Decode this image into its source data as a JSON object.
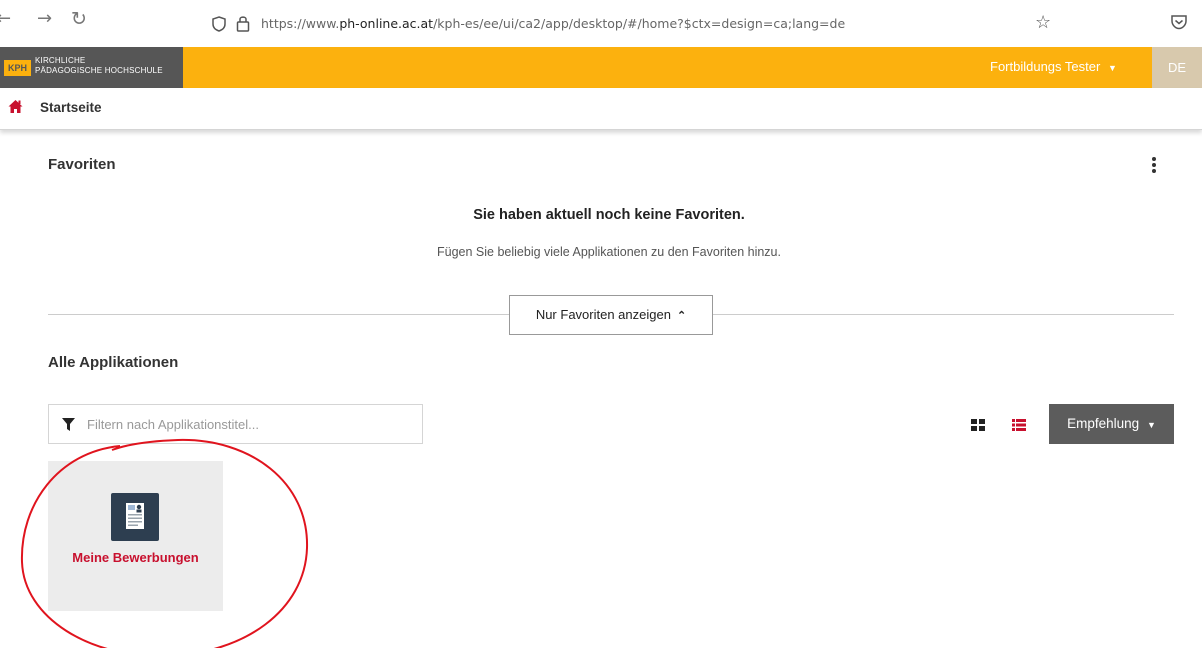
{
  "browser": {
    "url_prefix": "https://www.",
    "url_domain": "ph-online.ac.at",
    "url_path": "/kph-es/ee/ui/ca2/app/desktop/#/home?$ctx=design=ca;lang=de"
  },
  "header": {
    "logo_short": "KPH",
    "logo_line1": "KIRCHLICHE",
    "logo_line2": "PÄDAGOGISCHE HOCHSCHULE",
    "user_name": "Fortbildungs Tester",
    "language": "DE"
  },
  "breadcrumb": {
    "label": "Startseite"
  },
  "favorites": {
    "title": "Favoriten",
    "empty_title": "Sie haben aktuell noch keine Favoriten.",
    "empty_subtitle": "Fügen Sie beliebig viele Applikationen zu den Favoriten hinzu.",
    "toggle_label": "Nur Favoriten anzeigen"
  },
  "applications": {
    "title": "Alle Applikationen",
    "filter_placeholder": "Filtern nach Applikationstitel...",
    "sort_label": "Empfehlung",
    "items": [
      {
        "label": "Meine Bewerbungen",
        "icon": "application-document-icon"
      }
    ]
  },
  "colors": {
    "header_orange": "#fcb10e",
    "logo_gray": "#565656",
    "accent_red": "#c8102e",
    "sort_button": "#5c5c5c",
    "annotation_circle": "#e0141e"
  }
}
